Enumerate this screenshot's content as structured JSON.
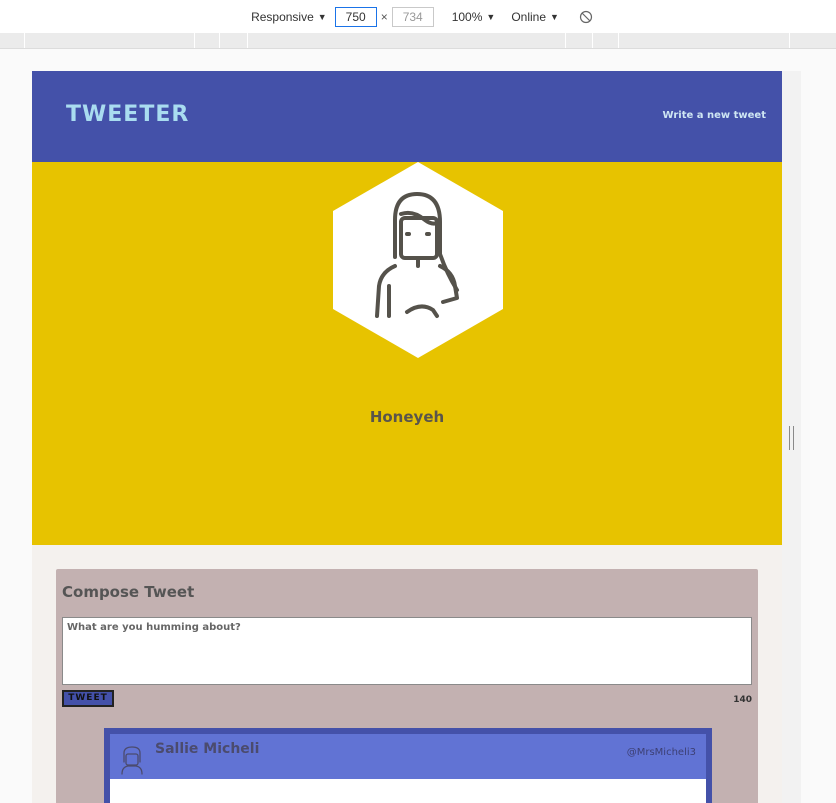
{
  "devtools": {
    "device": "Responsive",
    "width": "750",
    "times": "×",
    "height": "734",
    "zoom": "100%",
    "network": "Online",
    "rotate_icon": "rotate-icon"
  },
  "app": {
    "brand": "TWEETER",
    "nav_link": "Write a new tweet",
    "profile": {
      "name": "Honeyeh",
      "avatar_icon": "user-avatar-icon"
    },
    "compose": {
      "title": "Compose Tweet",
      "placeholder": "What are you humming about?",
      "button": "TWEET",
      "counter": "140"
    },
    "tweets": [
      {
        "name": "Sallie Micheli",
        "handle": "@MrsMicheli3",
        "avatar_icon": "user-avatar-icon"
      }
    ]
  },
  "colors": {
    "nav": "#4451a9",
    "hero": "#e7c300",
    "compose": "#c3b1b1",
    "tweet_head": "#6173d4",
    "brand_text": "#a9dcf0"
  }
}
